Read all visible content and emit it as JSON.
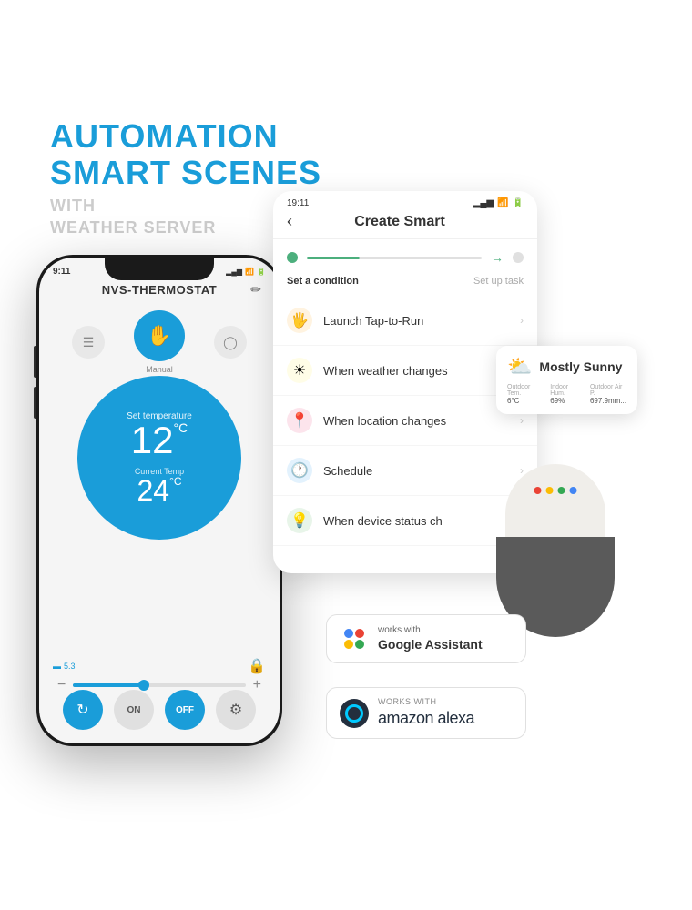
{
  "header": {
    "line1": "AUTOMATION",
    "line2": "SMART SCENES",
    "line3": "WITH",
    "line4": "WEATHER SERVER"
  },
  "phone": {
    "time": "9:11",
    "title": "NVS-THERMOSTAT",
    "manual_label": "Manual",
    "set_temp_label": "Set temperature",
    "set_temp_value": "12",
    "set_temp_unit": "°C",
    "current_temp_label": "Current Temp",
    "current_temp_value": "24",
    "current_temp_unit": "°C",
    "battery_value": "5.3"
  },
  "app_screen": {
    "time": "19:11",
    "title": "Create Smart",
    "step1_label": "Set a condition",
    "step2_label": "Set up task",
    "items": [
      {
        "icon": "🖐",
        "color": "orange",
        "label": "Launch Tap-to-Run"
      },
      {
        "icon": "☀",
        "color": "yellow",
        "label": "When weather changes"
      },
      {
        "icon": "📍",
        "color": "red",
        "label": "When location changes"
      },
      {
        "icon": "🕐",
        "color": "blue",
        "label": "Schedule"
      },
      {
        "icon": "💡",
        "color": "green",
        "label": "When device status ch"
      }
    ]
  },
  "weather_card": {
    "icon": "⛅",
    "title": "Mostly Sunny",
    "stats": [
      {
        "label": "Outdoor Tem.",
        "value": "6°C"
      },
      {
        "label": "Indoor Hum.",
        "value": "69%"
      },
      {
        "label": "Outdoor Air P.",
        "value": "697.9mm..."
      }
    ]
  },
  "google_assistant": {
    "works_with": "works with",
    "brand": "Google Assistant"
  },
  "amazon_alexa": {
    "works_with": "WORKS WITH",
    "brand": "amazon alexa"
  }
}
